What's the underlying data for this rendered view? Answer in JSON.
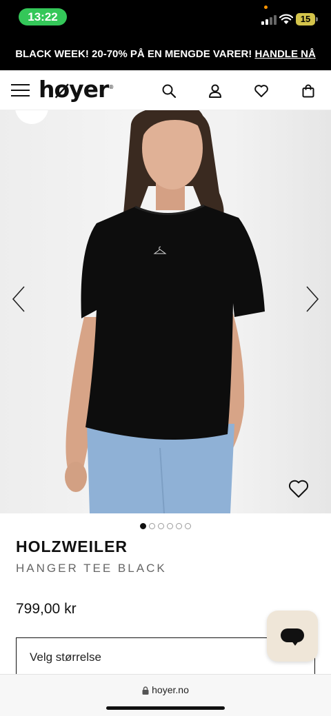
{
  "status_bar": {
    "time": "13:22",
    "battery": "15",
    "signal_icon": "cellular-signal-icon",
    "wifi_icon": "wifi-icon"
  },
  "promo": {
    "text": "BLACK WEEK! 20-70% PÅ EN MENGDE VARER!",
    "cta": "HANDLE NÅ"
  },
  "header": {
    "logo": "høyer",
    "logo_mark": "®",
    "icons": [
      "menu-icon",
      "search-icon",
      "account-icon",
      "wishlist-icon",
      "bag-icon"
    ]
  },
  "gallery": {
    "image_count": 6,
    "active_index": 0
  },
  "product": {
    "brand": "HOLZWEILER",
    "name": "HANGER TEE BLACK",
    "price": "799,00 kr",
    "size_placeholder": "Velg størrelse"
  },
  "browser": {
    "url": "hoyer.no"
  },
  "colors": {
    "accent_green": "#34c759",
    "banner_bg": "#000000",
    "chat_bg": "#efe6d8"
  }
}
